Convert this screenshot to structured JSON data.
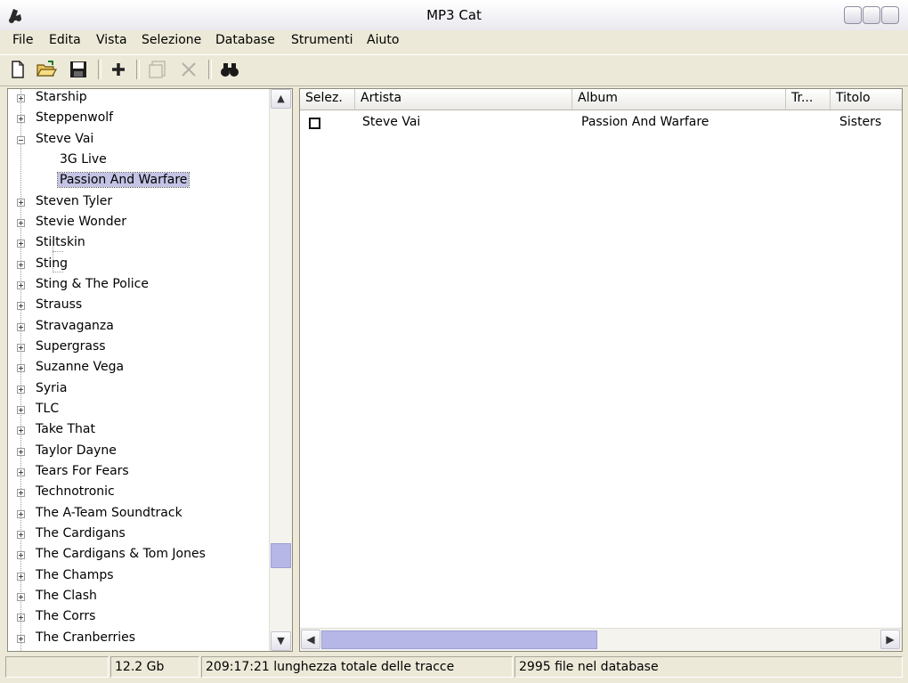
{
  "window": {
    "title": "MP3 Cat"
  },
  "menu": [
    "File",
    "Edita",
    "Vista",
    "Selezione",
    "Database",
    "Strumenti",
    "Aiuto"
  ],
  "toolbar": {
    "icons": [
      "new-file-icon",
      "open-folder-icon",
      "save-icon",
      "add-icon",
      "properties-icon",
      "delete-icon",
      "find-icon"
    ]
  },
  "tree": {
    "items": [
      {
        "label": "Starship",
        "expanded": false
      },
      {
        "label": "Steppenwolf",
        "expanded": false
      },
      {
        "label": "Steve Vai",
        "expanded": true
      },
      {
        "label": "3G Live",
        "child": true
      },
      {
        "label": "Passion And Warfare",
        "child": true,
        "selected": true
      },
      {
        "label": "Steven Tyler",
        "expanded": false
      },
      {
        "label": "Stevie Wonder",
        "expanded": false
      },
      {
        "label": "Stiltskin",
        "expanded": false
      },
      {
        "label": "Sting",
        "expanded": false
      },
      {
        "label": "Sting & The Police",
        "expanded": false
      },
      {
        "label": "Strauss",
        "expanded": false
      },
      {
        "label": "Stravaganza",
        "expanded": false
      },
      {
        "label": "Supergrass",
        "expanded": false
      },
      {
        "label": "Suzanne Vega",
        "expanded": false
      },
      {
        "label": "Syria",
        "expanded": false
      },
      {
        "label": "TLC",
        "expanded": false
      },
      {
        "label": "Take That",
        "expanded": false
      },
      {
        "label": "Taylor Dayne",
        "expanded": false
      },
      {
        "label": "Tears For Fears",
        "expanded": false
      },
      {
        "label": "Technotronic",
        "expanded": false
      },
      {
        "label": "The A-Team Soundtrack",
        "expanded": false
      },
      {
        "label": "The Cardigans",
        "expanded": false
      },
      {
        "label": "The Cardigans & Tom Jones",
        "expanded": false
      },
      {
        "label": "The Champs",
        "expanded": false
      },
      {
        "label": "The Clash",
        "expanded": false
      },
      {
        "label": "The Corrs",
        "expanded": false
      },
      {
        "label": "The Cranberries",
        "expanded": false
      }
    ]
  },
  "list": {
    "columns": [
      "Selez.",
      "Artista",
      "Album",
      "Tr...",
      "Titolo"
    ],
    "rows": [
      {
        "artist": "Steve Vai",
        "album": "Passion And Warfare",
        "title": "Sisters",
        "checked": false
      }
    ]
  },
  "status": {
    "size": "12.2 Gb",
    "duration": "209:17:21 lunghezza totale delle tracce",
    "files": "2995 file nel database"
  },
  "colors": {
    "selection": "#c3c3e6",
    "scroll_thumb": "#b6b7e6"
  }
}
